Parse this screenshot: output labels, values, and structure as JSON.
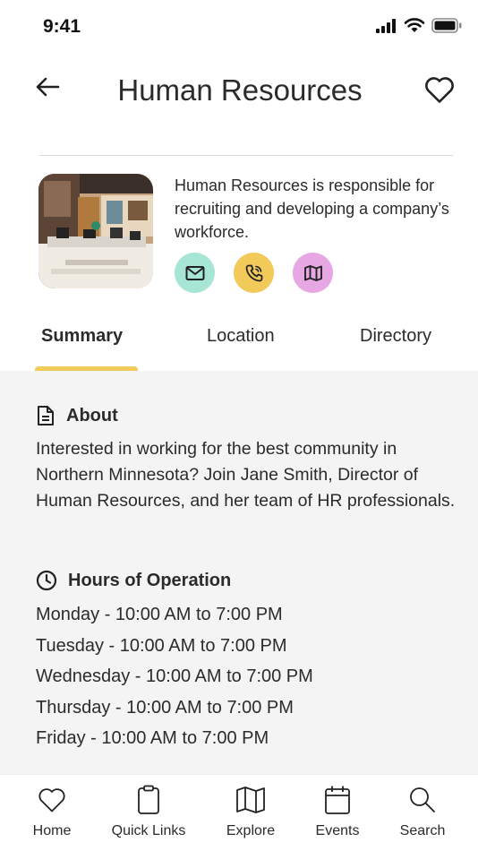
{
  "status_bar": {
    "time": "9:41"
  },
  "header": {
    "title": "Human Resources"
  },
  "profile": {
    "description": "Human Resources is responsible for recruiting and developing a company’s workforce.",
    "contacts": [
      {
        "icon": "mail-icon",
        "color": "#a7e6d4"
      },
      {
        "icon": "phone-icon",
        "color": "#f2ca5a"
      },
      {
        "icon": "map-icon",
        "color": "#e7a7e3"
      }
    ]
  },
  "tabs": [
    {
      "label": "Summary",
      "active": true
    },
    {
      "label": "Location",
      "active": false
    },
    {
      "label": "Directory",
      "active": false
    }
  ],
  "about": {
    "title": "About",
    "text": "Interested in working for the best community in Northern Minnesota? Join Jane Smith, Director of Human Resources, and her team of HR professionals."
  },
  "hours": {
    "title": "Hours of Operation",
    "rows": [
      "Monday - 10:00 AM to 7:00 PM",
      "Tuesday - 10:00 AM to 7:00 PM",
      "Wednesday - 10:00 AM to 7:00 PM",
      "Thursday - 10:00 AM to 7:00 PM",
      "Friday - 10:00 AM to 7:00 PM"
    ]
  },
  "tabbar": [
    {
      "label": "Home",
      "icon": "heart-icon"
    },
    {
      "label": "Quick Links",
      "icon": "clipboard-icon"
    },
    {
      "label": "Explore",
      "icon": "map-icon"
    },
    {
      "label": "Events",
      "icon": "calendar-icon"
    },
    {
      "label": "Search",
      "icon": "search-icon"
    }
  ],
  "colors": {
    "accent": "#f2ca5a",
    "content_bg": "#f4f4f4"
  }
}
